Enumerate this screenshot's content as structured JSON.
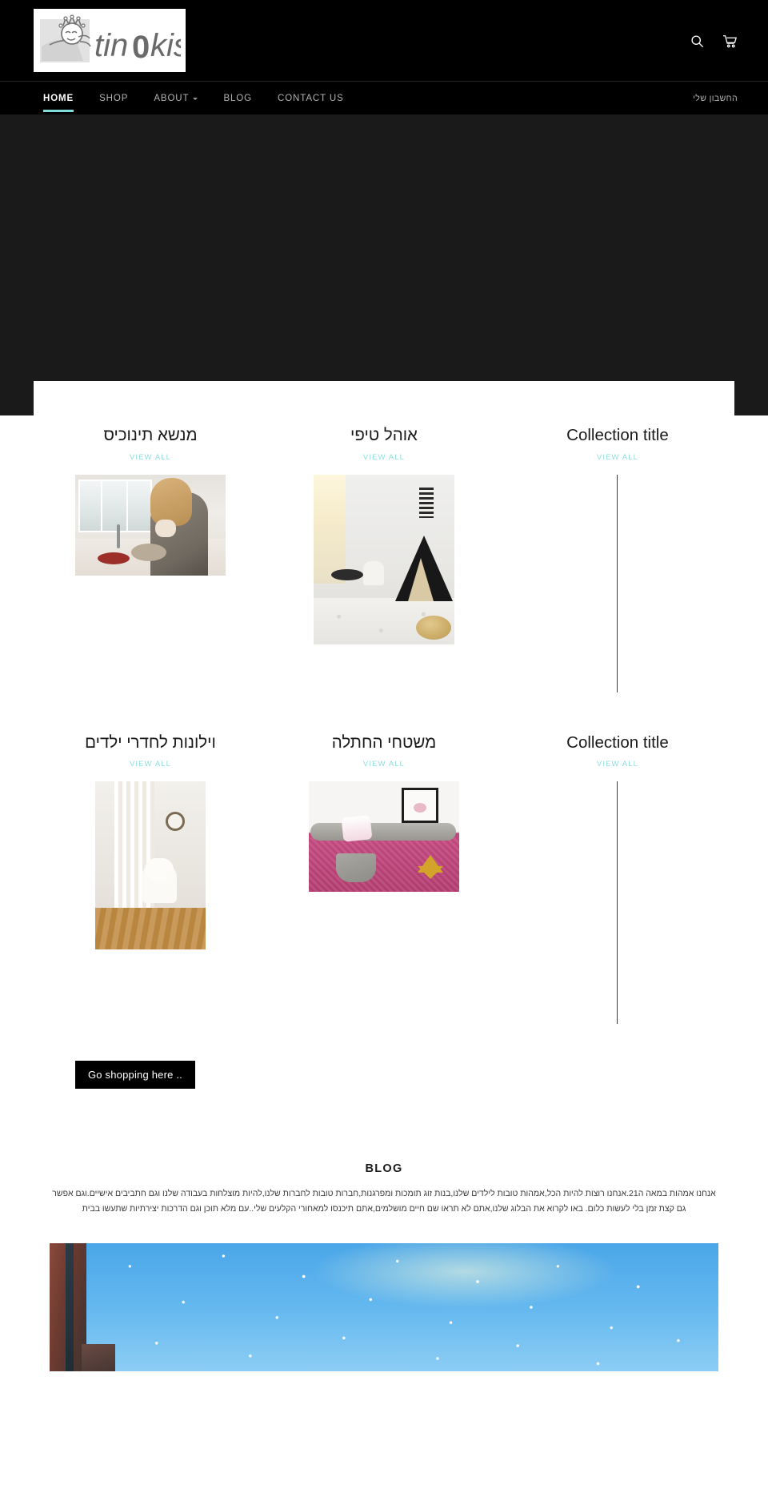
{
  "header": {
    "logo_text": "tinokis",
    "logo_alt": "tinokis-logo",
    "search_icon": "search-icon",
    "cart_icon": "cart-icon"
  },
  "nav": {
    "items": [
      {
        "label": "HOME",
        "active": true,
        "has_dropdown": false
      },
      {
        "label": "SHOP",
        "active": false,
        "has_dropdown": false
      },
      {
        "label": "ABOUT",
        "active": false,
        "has_dropdown": true
      },
      {
        "label": "BLOG",
        "active": false,
        "has_dropdown": false
      },
      {
        "label": "CONTACT US",
        "active": false,
        "has_dropdown": false
      }
    ],
    "account_label": "החשבון שלי",
    "active_underline_color": "#7fdcd8"
  },
  "collections": {
    "view_all_label": "VIEW ALL",
    "view_all_color": "#8fdcdc",
    "rule_color": "#6e2a28",
    "row1": [
      {
        "title": "מנשא תינוכיס",
        "rtl": true,
        "media": "carrier"
      },
      {
        "title": "אוהל טיפי",
        "rtl": true,
        "media": "teepee"
      },
      {
        "title": "Collection title",
        "rtl": false,
        "media": "rule"
      }
    ],
    "row2": [
      {
        "title": "וילונות לחדרי ילדים",
        "rtl": true,
        "media": "curtain"
      },
      {
        "title": "משטחי החתלה",
        "rtl": true,
        "media": "bed"
      },
      {
        "title": "Collection title",
        "rtl": false,
        "media": "rule"
      }
    ]
  },
  "shop_button": {
    "label": "Go shopping here .."
  },
  "blog": {
    "heading": "BLOG",
    "body": "אנחנו  אמהות  במאה  ה21.אנחנו רוצות להיות הכל,אמהות טובות לילדים שלנו,בנות זוג תומכות ומפרגנות,חברות טובות לחברות שלנו,להיות מוצלחות בעבודה שלנו וגם חתביבים אישיים.וגם אפשר  גם  קצת  זמן  בלי  לעשות כלום.  באו  לקרוא  את  הבלוג  שלנו,אתם  לא  תראו  שם  חיים  מושלמים,אתם  תיכנסו  למאחורי  הקלעים  שלי..עם  מלא  תוכן  וגם  הדרכות  יצירתיות  שתעשו  בבית",
    "image_alt": "string-lights-sky-photo"
  },
  "colors": {
    "header_bg": "#000000",
    "hero_bg": "#1a1a1a",
    "page_bg": "#ffffff",
    "accent": "#7fdcd8"
  }
}
